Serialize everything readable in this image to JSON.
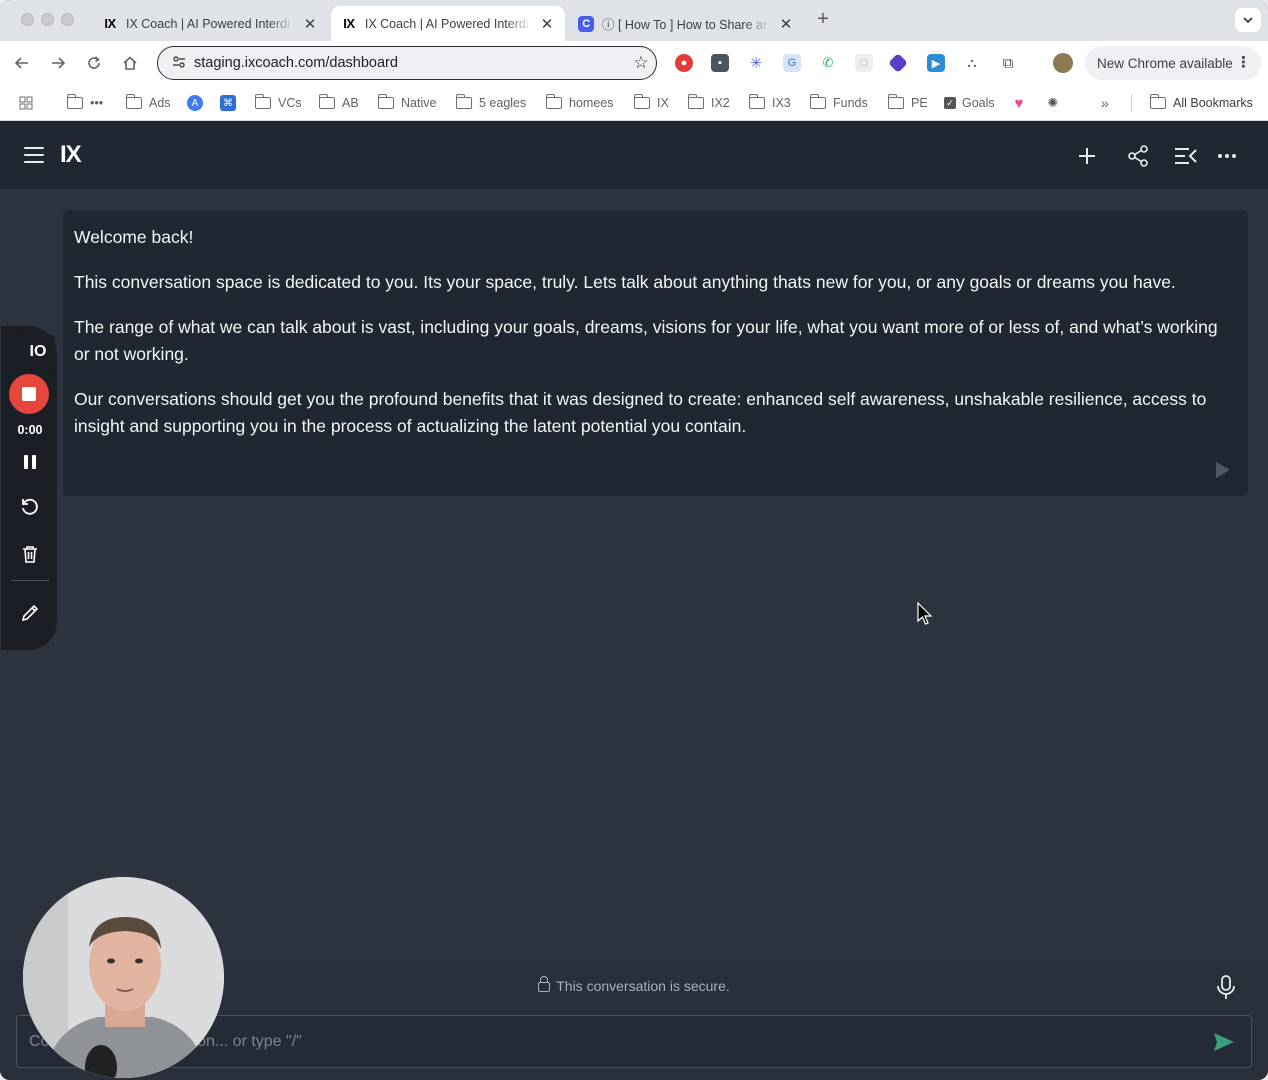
{
  "browser": {
    "tabs": [
      {
        "favicon": "IX",
        "title": "IX Coach | AI Powered Interdi",
        "close": "✕"
      },
      {
        "favicon": "IX",
        "title": "IX Coach | AI Powered Interdi",
        "close": "✕"
      },
      {
        "favicon": "C",
        "title": "ⓘ [ How To ] How to Share ar",
        "close": "✕"
      }
    ],
    "new_tab": "+",
    "url": "staging.ixcoach.com/dashboard",
    "update_label": "New Chrome available",
    "bookmarks": [
      {
        "label": "•••",
        "type": "folder"
      },
      {
        "label": "Ads",
        "type": "folder"
      },
      {
        "label": "",
        "type": "icon"
      },
      {
        "label": "",
        "type": "icon"
      },
      {
        "label": "VCs",
        "type": "folder"
      },
      {
        "label": "AB",
        "type": "folder"
      },
      {
        "label": "Native",
        "type": "folder"
      },
      {
        "label": "5 eagles",
        "type": "folder"
      },
      {
        "label": "homees",
        "type": "folder"
      },
      {
        "label": "IX",
        "type": "folder"
      },
      {
        "label": "IX2",
        "type": "folder"
      },
      {
        "label": "IX3",
        "type": "folder"
      },
      {
        "label": "Funds",
        "type": "folder"
      },
      {
        "label": "PE",
        "type": "folder"
      },
      {
        "label": "Goals",
        "type": "checkbox"
      }
    ],
    "more_bookmarks": "»",
    "all_bookmarks": "All Bookmarks"
  },
  "app": {
    "logo": "IX",
    "message": {
      "greeting": "Welcome back!",
      "para1": "This conversation space is dedicated to you. Its your space, truly. Lets talk about anything thats new for you, or any goals or dreams you have.",
      "para2": "The range of what we can talk about is vast, including your goals, dreams, visions for your life, what you want more of or less of, and what’s working or not working.",
      "para3": "Our conversations should get you the profound benefits that it was designed to create: enhanced self awareness, unshakable resilience, access to insight and supporting you in the process of actualizing the latent potential you contain."
    },
    "secure_note": "This conversation is secure.",
    "input_placeholder": "Continue the conversation... or type \"/\""
  },
  "recorder": {
    "badge": "IO",
    "timer": "0:00"
  },
  "colors": {
    "app_bg": "#2d3440",
    "app_header": "#202632",
    "record_red": "#e5473c",
    "send_green": "#3aa07a"
  }
}
